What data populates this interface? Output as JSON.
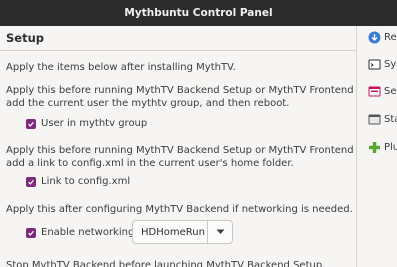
{
  "window": {
    "title": "Mythbuntu Control Panel"
  },
  "setup": {
    "header": "Setup",
    "intro": "Apply the items below after installing MythTV.",
    "mythtv_group": {
      "desc_line1": "Apply this before running MythTV Backend Setup or MythTV Frontend to",
      "desc_line2": "add the current user the mythtv group, and then reboot.",
      "checkbox_label": "User in mythtv group",
      "checked": true
    },
    "config_link": {
      "desc_line1": "Apply this before running MythTV Backend Setup or MythTV Frontend to",
      "desc_line2": "add a link to config.xml in the current user's home folder.",
      "checkbox_label": "Link to config.xml",
      "checked": true
    },
    "networking": {
      "desc": "Apply this after configuring MythTV Backend if networking is needed.",
      "checkbox_label": "Enable networking",
      "checked": true,
      "combo_value": "HDHomeRun"
    },
    "backend_stop": {
      "desc": "Stop MythTV Backend before launching MythTV Backend Setup."
    }
  },
  "sidebar": {
    "items": [
      {
        "label": "Re",
        "icon": "down-arrow-circle-icon",
        "color": "#3a7bd5"
      },
      {
        "label": "Sys",
        "icon": "terminal-icon",
        "color": "#2e2e2e"
      },
      {
        "label": "Se",
        "icon": "settings-window-icon",
        "color": "#c2185b"
      },
      {
        "label": "Sta",
        "icon": "startup-window-icon",
        "color": "#555555"
      },
      {
        "label": "Plu",
        "icon": "plus-icon",
        "color": "#5aa832"
      }
    ]
  },
  "colors": {
    "accent": "#7e2a7c",
    "titlebar": "#2c2c2c"
  }
}
